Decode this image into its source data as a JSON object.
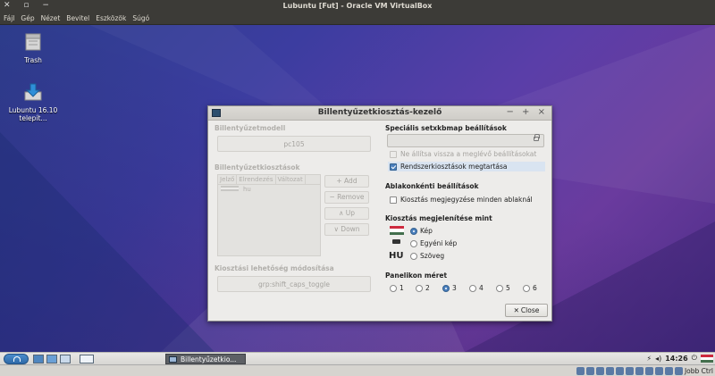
{
  "host": {
    "title": "Lubuntu [Fut] - Oracle VM VirtualBox",
    "menu": [
      "Fájl",
      "Gép",
      "Nézet",
      "Bevitel",
      "Eszközök",
      "Súgó"
    ],
    "host_key": "Jobb Ctrl"
  },
  "desktop": {
    "icons": [
      {
        "label": "Trash"
      },
      {
        "label": "Lubuntu 16.10 telepít..."
      }
    ]
  },
  "dialog": {
    "title": "Billentyűzetkiosztás-kezelő",
    "keyboard_model": {
      "heading": "Billentyűzetmodell",
      "value": "pc105"
    },
    "layouts": {
      "heading": "Billentyűzetkiosztások",
      "columns": [
        "Jelző",
        "Elrendezés",
        "Változat"
      ],
      "rows": [
        {
          "layout": "hu"
        }
      ],
      "buttons": {
        "add": "+ Add",
        "remove": "− Remove",
        "up": "∧ Up",
        "down": "∨ Down"
      }
    },
    "switch_option": {
      "heading": "Kiosztási lehetőség módosítása",
      "value": "grp:shift_caps_toggle"
    },
    "setxkbmap": {
      "heading": "Speciális setxkbmap beállítások",
      "input_value": "",
      "no_reset_label": "Ne állítsa vissza a meglévő beállításokat",
      "keep_system_label": "Rendszerkiosztások megtartása"
    },
    "per_window": {
      "heading": "Ablakonkénti beállítások",
      "remember_label": "Kiosztás megjegyzése minden ablaknál"
    },
    "display_as": {
      "heading": "Kiosztás megjelenítése mint",
      "options": [
        "Kép",
        "Egyéni kép",
        "Szöveg"
      ],
      "selected": "Kép",
      "text_sample": "HU"
    },
    "panel_size": {
      "heading": "Panelikon méret",
      "options": [
        "1",
        "2",
        "3",
        "4",
        "5",
        "6"
      ],
      "selected": "3"
    },
    "close_label": "Close"
  },
  "taskbar": {
    "task_label": "Billentyűzetkio...",
    "clock": "14:26"
  },
  "colors": {
    "flag_red": "#cd2a3e",
    "flag_white": "#ffffff",
    "flag_green": "#436f4d",
    "accent": "#4a7fbd"
  }
}
